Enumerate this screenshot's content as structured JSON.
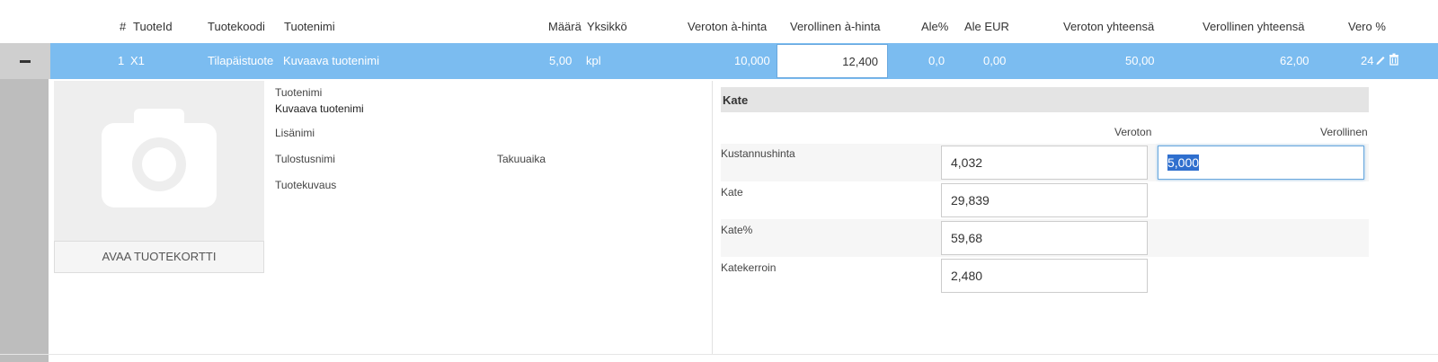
{
  "header": {
    "col_num": "#",
    "col_id": "TuoteId",
    "col_code": "Tuotekoodi",
    "col_name": "Tuotenimi",
    "col_qty": "Määrä",
    "col_unit": "Yksikkö",
    "col_net_price": "Veroton à-hinta",
    "col_gross_price": "Verollinen à-hinta",
    "col_disc_pct": "Ale%",
    "col_disc_eur": "Ale EUR",
    "col_net_total": "Veroton yhteensä",
    "col_gross_total": "Verollinen yhteensä",
    "col_vat": "Vero %"
  },
  "row": {
    "num": "1",
    "id": "X1",
    "code": "Tilapäistuote",
    "name": "Kuvaava tuotenimi",
    "qty": "5,00",
    "unit": "kpl",
    "net_price": "10,000",
    "gross_price": "12,400",
    "disc_pct": "0,0",
    "disc_eur": "0,00",
    "net_total": "50,00",
    "gross_total": "62,00",
    "vat": "24"
  },
  "detail": {
    "open_card_label": "AVAA TUOTEKORTTI",
    "product_name_label": "Tuotenimi",
    "product_name_value": "Kuvaava tuotenimi",
    "extra_name_label": "Lisänimi",
    "print_name_label": "Tulostusnimi",
    "warranty_label": "Takuuaika",
    "description_label": "Tuotekuvaus"
  },
  "margin": {
    "title": "Kate",
    "col_net": "Veroton",
    "col_gross": "Verollinen",
    "cost_label": "Kustannushinta",
    "cost_net": "4,032",
    "cost_gross": "5,000",
    "margin_label": "Kate",
    "margin_value": "29,839",
    "margin_pct_label": "Kate%",
    "margin_pct_value": "59,68",
    "multiplier_label": "Katekerroin",
    "multiplier_value": "2,480"
  },
  "icons": {
    "collapse": "minus-icon",
    "edit": "pencil-icon",
    "delete": "trash-icon",
    "photo": "camera-icon"
  }
}
